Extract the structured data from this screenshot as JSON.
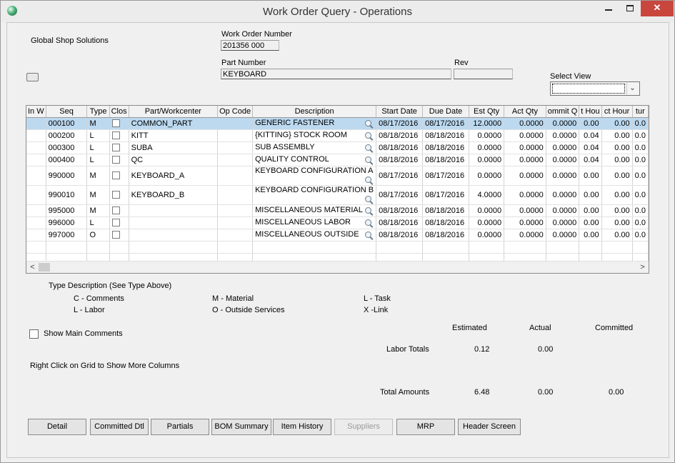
{
  "window": {
    "title": "Work Order Query - Operations",
    "min_glyph": "",
    "max_glyph": "",
    "close_glyph": "✕"
  },
  "header": {
    "company": "Global Shop Solutions",
    "work_order_label": "Work Order Number",
    "work_order_value": "201356 000",
    "part_number_label": "Part Number",
    "part_number_value": "KEYBOARD",
    "rev_label": "Rev",
    "rev_value": "",
    "select_view_label": "Select View",
    "select_view_value": ""
  },
  "grid": {
    "columns": [
      "In W",
      "Seq",
      "Type",
      "Clos",
      "Part/Workcenter",
      "Op Code",
      "Description",
      "Start Date",
      "Due Date",
      "Est Qty",
      "Act Qty",
      "ommit Q",
      "t Hou",
      "ct Hour",
      "tur"
    ],
    "rows": [
      {
        "seq": "000100",
        "type": "M",
        "part": "COMMON_PART",
        "opcode": "",
        "desc": "GENERIC FASTENER",
        "start": "08/17/2016",
        "due": "08/17/2016",
        "est": "12.0000",
        "act": "0.0000",
        "commit": "0.0000",
        "thou": "0.00",
        "acthour": "0.00",
        "tur": "0.0"
      },
      {
        "seq": "000200",
        "type": "L",
        "part": "KITT",
        "opcode": "",
        "desc": "{KITTING} STOCK ROOM",
        "start": "08/18/2016",
        "due": "08/18/2016",
        "est": "0.0000",
        "act": "0.0000",
        "commit": "0.0000",
        "thou": "0.04",
        "acthour": "0.00",
        "tur": "0.0"
      },
      {
        "seq": "000300",
        "type": "L",
        "part": "SUBA",
        "opcode": "",
        "desc": "SUB ASSEMBLY",
        "start": "08/18/2016",
        "due": "08/18/2016",
        "est": "0.0000",
        "act": "0.0000",
        "commit": "0.0000",
        "thou": "0.04",
        "acthour": "0.00",
        "tur": "0.0"
      },
      {
        "seq": "000400",
        "type": "L",
        "part": "QC",
        "opcode": "",
        "desc": "QUALITY CONTROL",
        "start": "08/18/2016",
        "due": "08/18/2016",
        "est": "0.0000",
        "act": "0.0000",
        "commit": "0.0000",
        "thou": "0.04",
        "acthour": "0.00",
        "tur": "0.0"
      },
      {
        "seq": "990000",
        "type": "M",
        "part": "KEYBOARD_A",
        "opcode": "",
        "desc": "KEYBOARD CONFIGURATION A",
        "start": "08/17/2016",
        "due": "08/17/2016",
        "est": "0.0000",
        "act": "0.0000",
        "commit": "0.0000",
        "thou": "0.00",
        "acthour": "0.00",
        "tur": "0.0"
      },
      {
        "seq": "990010",
        "type": "M",
        "part": "KEYBOARD_B",
        "opcode": "",
        "desc": "KEYBOARD CONFIGURATION B",
        "start": "08/17/2016",
        "due": "08/17/2016",
        "est": "4.0000",
        "act": "0.0000",
        "commit": "0.0000",
        "thou": "0.00",
        "acthour": "0.00",
        "tur": "0.0"
      },
      {
        "seq": "995000",
        "type": "M",
        "part": "",
        "opcode": "",
        "desc": "MISCELLANEOUS MATERIAL",
        "start": "08/18/2016",
        "due": "08/18/2016",
        "est": "0.0000",
        "act": "0.0000",
        "commit": "0.0000",
        "thou": "0.00",
        "acthour": "0.00",
        "tur": "0.0"
      },
      {
        "seq": "996000",
        "type": "L",
        "part": "",
        "opcode": "",
        "desc": "MISCELLANEOUS LABOR",
        "start": "08/18/2016",
        "due": "08/18/2016",
        "est": "0.0000",
        "act": "0.0000",
        "commit": "0.0000",
        "thou": "0.00",
        "acthour": "0.00",
        "tur": "0.0"
      },
      {
        "seq": "997000",
        "type": "O",
        "part": "",
        "opcode": "",
        "desc": "MISCELLANEOUS OUTSIDE",
        "start": "08/18/2016",
        "due": "08/18/2016",
        "est": "0.0000",
        "act": "0.0000",
        "commit": "0.0000",
        "thou": "0.00",
        "acthour": "0.00",
        "tur": "0.0"
      }
    ],
    "scroll_left": "<",
    "scroll_right": ">"
  },
  "legend": {
    "heading": "Type Description (See Type Above)",
    "c": "C - Comments",
    "m": "M - Material",
    "l_task": "L - Task",
    "l_labor": "L - Labor",
    "o": "O - Outside Services",
    "x": "X -Link"
  },
  "options": {
    "show_main_comments": "Show Main Comments",
    "hint": "Right Click on Grid to Show More Columns"
  },
  "totals": {
    "estimated_label": "Estimated",
    "actual_label": "Actual",
    "committed_label": "Committed",
    "labor_label": "Labor Totals",
    "labor_estimated": "0.12",
    "labor_actual": "0.00",
    "amount_label": "Total Amounts",
    "amount_estimated": "6.48",
    "amount_actual": "0.00",
    "amount_committed": "0.00"
  },
  "buttons": {
    "detail": "Detail",
    "committed_dtl": "Committed Dtl",
    "partials": "Partials",
    "bom_summary": "BOM Summary",
    "item_history": "Item History",
    "suppliers": "Suppliers",
    "mrp": "MRP",
    "header_screen": "Header Screen"
  },
  "colors": {
    "selected_row": "#bcd9f0",
    "close_button": "#c9463d"
  }
}
